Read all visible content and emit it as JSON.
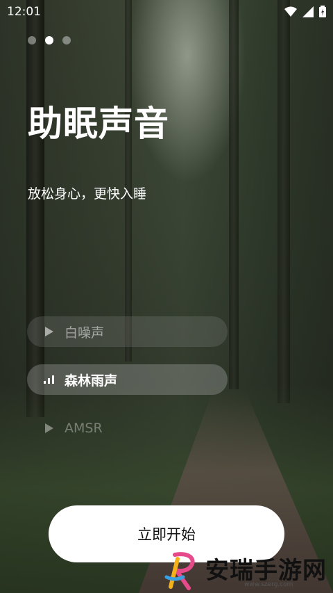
{
  "status_bar": {
    "time": "12:01"
  },
  "onboarding": {
    "page_count": 3,
    "active_page": 2,
    "title": "助眠声音",
    "subtitle": "放松身心，更快入睡"
  },
  "sound_options": [
    {
      "label": "白噪声",
      "state": "dim",
      "icon": "play-icon"
    },
    {
      "label": "森林雨声",
      "state": "active",
      "icon": "equalizer-icon"
    },
    {
      "label": "AMSR",
      "state": "faint",
      "icon": "play-icon"
    }
  ],
  "start_button": {
    "label": "立即开始"
  },
  "watermark": {
    "text": "安瑞手游网",
    "url": "www.szerg.com"
  },
  "colors": {
    "accent": "#ffffff",
    "button_text": "#111111"
  }
}
